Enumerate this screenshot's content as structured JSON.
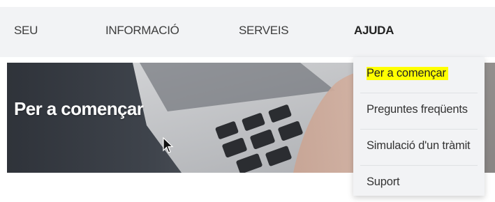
{
  "nav": {
    "items": [
      {
        "label": "SEU"
      },
      {
        "label": "INFORMACIÓ"
      },
      {
        "label": "SERVEIS"
      },
      {
        "label": "AJUDA"
      }
    ]
  },
  "hero": {
    "title": "Per a començar"
  },
  "dropdown": {
    "items": [
      {
        "label": "Per a començar",
        "highlighted": true
      },
      {
        "label": "Preguntes freqüents"
      },
      {
        "label": "Simulació d'un tràmit"
      },
      {
        "label": "Suport"
      }
    ]
  },
  "colors": {
    "highlight": "#ffff00",
    "nav_background": "#f2f3f5",
    "hero_text": "#ffffff"
  }
}
